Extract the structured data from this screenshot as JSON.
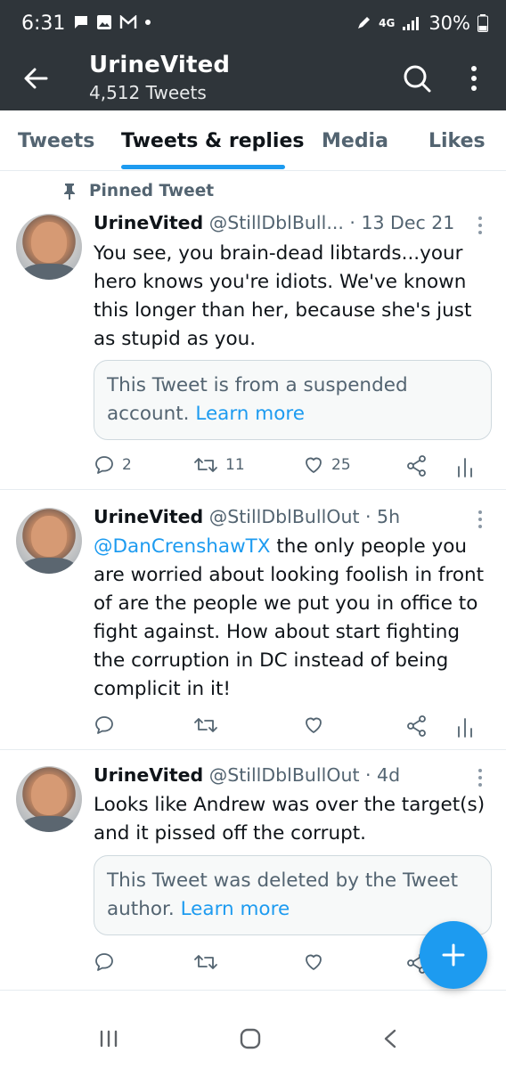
{
  "status_bar": {
    "time": "6:31",
    "network": "4G",
    "battery": "30%"
  },
  "header": {
    "title": "UrineVited",
    "subtitle": "4,512 Tweets"
  },
  "tabs": [
    {
      "label": "Tweets"
    },
    {
      "label": "Tweets & replies",
      "active": true
    },
    {
      "label": "Media"
    },
    {
      "label": "Likes"
    }
  ],
  "tweets": [
    {
      "pinned_label": "Pinned Tweet",
      "name": "UrineVited",
      "handle": "@StillDblBull...",
      "time": "· 13 Dec 21",
      "text": "You see, you brain-dead libtards...your hero knows you're idiots. We've known this longer than her, because she's just as stupid as you.",
      "notice": "This Tweet is from a suspended account.",
      "notice_link": "Learn more",
      "replies": "2",
      "retweets": "11",
      "likes": "25"
    },
    {
      "name": "UrineVited",
      "handle": "@StillDblBullOut",
      "time": "· 5h",
      "mention": "@DanCrenshawTX",
      "text": " the only people you are worried about looking foolish in front of are the people we put you in office to fight against. How about start fighting the corruption in DC instead of being complicit in it!"
    },
    {
      "name": "UrineVited",
      "handle": "@StillDblBullOut",
      "time": "· 4d",
      "text": "Looks like Andrew was over the target(s) and it pissed off the corrupt.",
      "notice": "This Tweet was deleted by the Tweet author.",
      "notice_link": "Learn more"
    }
  ],
  "colors": {
    "accent": "#1d9bf0",
    "header_bg": "#2f353a",
    "secondary_text": "#536471"
  },
  "icons": [
    "back-arrow-icon",
    "search-icon",
    "more-vertical-icon",
    "pin-icon",
    "reply-icon",
    "retweet-icon",
    "like-icon",
    "share-icon",
    "analytics-icon",
    "compose-plus-icon"
  ]
}
